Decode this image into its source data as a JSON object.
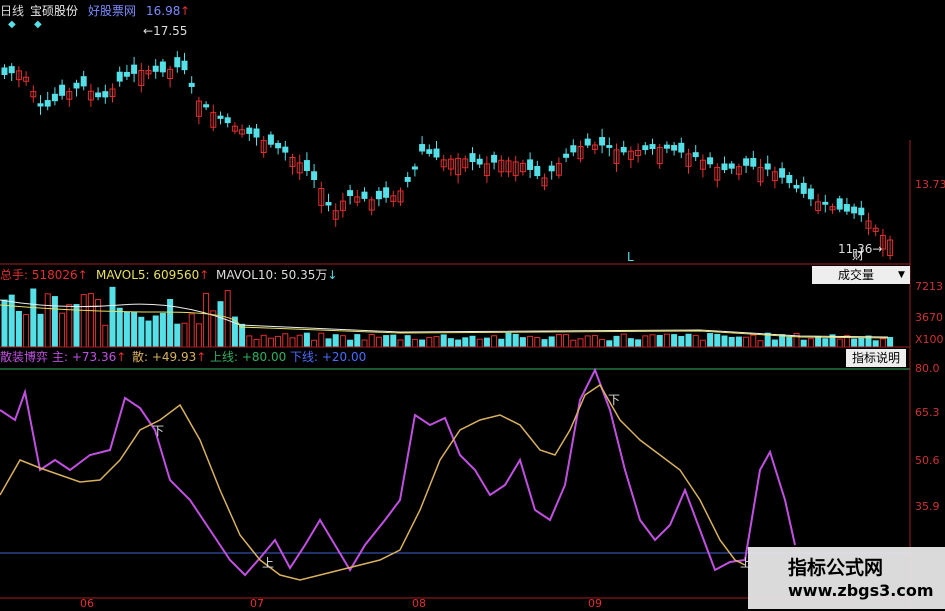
{
  "header": {
    "period": "日线",
    "stock_name": "宝硕股份",
    "link_label": "好股票网",
    "price": "16.98",
    "price_arrow": "↑",
    "high_label": "17.55",
    "low_label": "11.36",
    "marker_l": "L",
    "marker_cai": "财"
  },
  "price_axis": [
    "13.73"
  ],
  "volume": {
    "total_label": "总手: 518026",
    "total_arrow": "↑",
    "ma5_label": "MAVOL5: 609560",
    "ma5_arrow": "↑",
    "ma10_label": "MAVOL10: 50.35万",
    "ma10_arrow": "↓",
    "dropdown": "成交量",
    "axis": [
      "7213",
      "3670",
      "X100"
    ]
  },
  "indicator": {
    "name": "散装博弈",
    "main_label": "主: +73.36",
    "main_arrow": "↑",
    "retail_label": "散: +49.93",
    "retail_arrow": "↑",
    "upper_label": "上线: +80.00",
    "lower_label": "下线: +20.00",
    "help_button": "指标说明",
    "axis": [
      "80.0",
      "65.3",
      "50.6",
      "35.9"
    ],
    "cross_up": "上",
    "cross_down": "下"
  },
  "time_axis": [
    "06",
    "07",
    "08",
    "09"
  ],
  "watermark": {
    "line1": "指标公式网",
    "line2": "www.zbgs3.com"
  },
  "colors": {
    "up": "#e03030",
    "down": "#55e0e8",
    "purple": "#c050e0",
    "gold": "#d8b060",
    "blue_line": "#4060d0",
    "green_line": "#30b060"
  }
}
